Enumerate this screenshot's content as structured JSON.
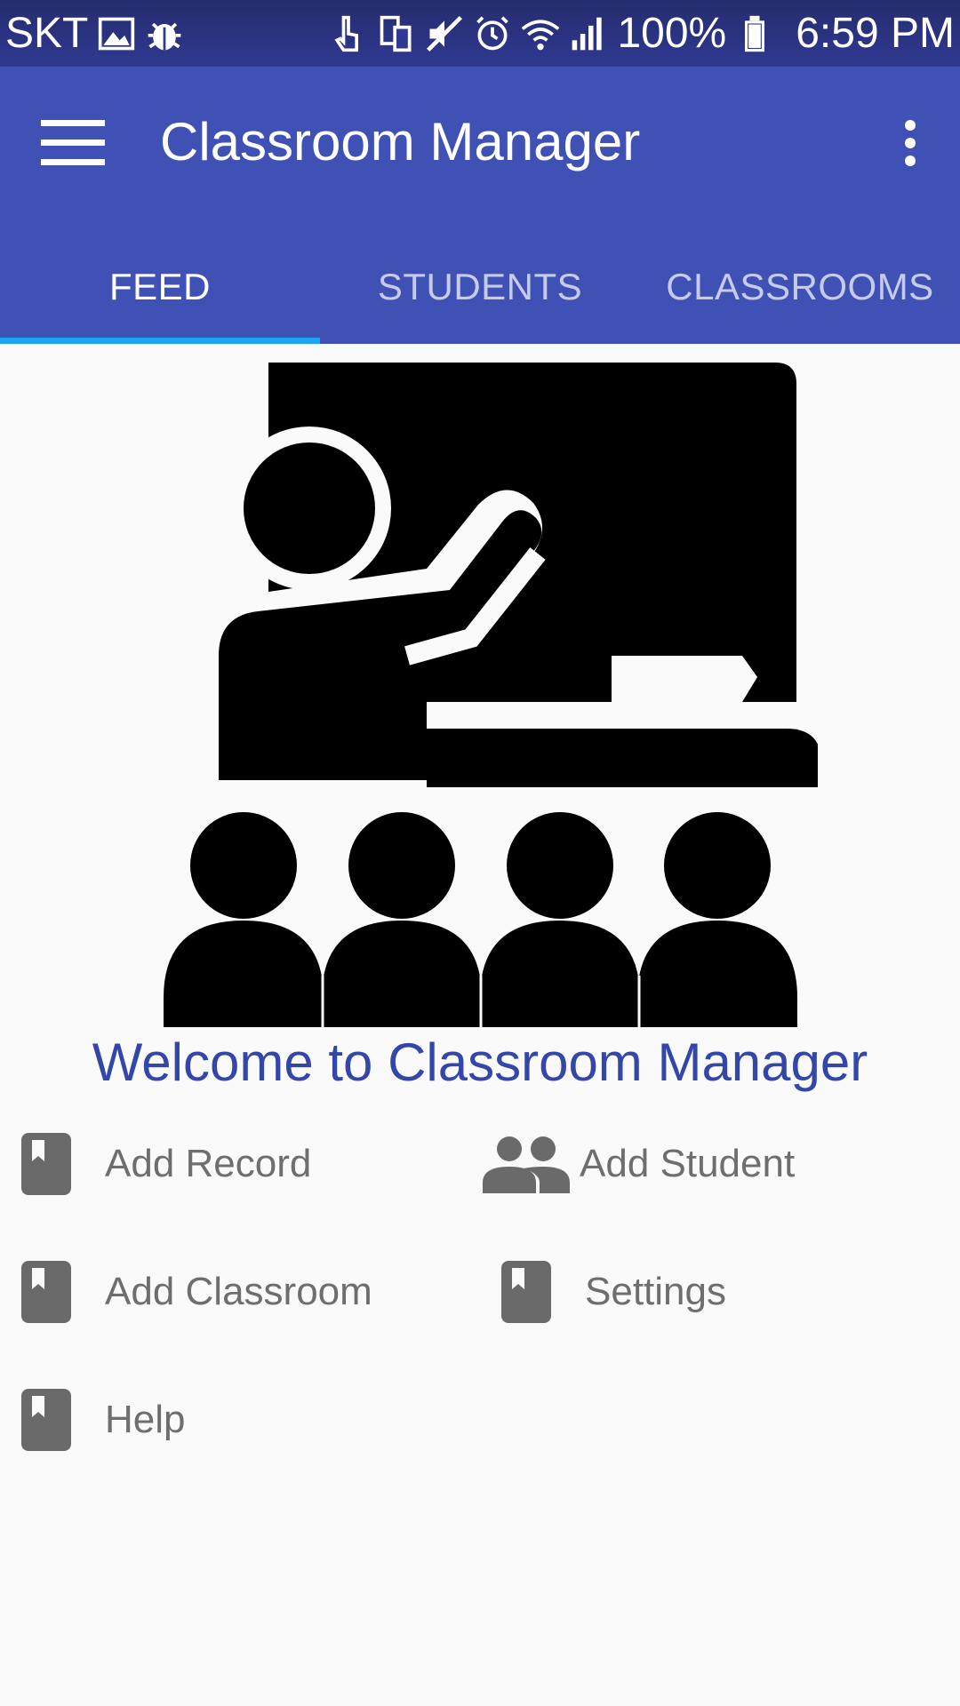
{
  "status_bar": {
    "carrier": "SKT",
    "battery": "100%",
    "time": "6:59 PM",
    "left_icons": [
      "image-icon",
      "bug-icon"
    ],
    "right_icons": [
      "touch-icon",
      "devices-icon",
      "mute-icon",
      "alarm-icon",
      "wifi-icon",
      "signal-icon",
      "battery-icon"
    ]
  },
  "toolbar": {
    "title": "Classroom Manager",
    "menu_icon": "hamburger-menu-icon",
    "overflow_icon": "more-vert-icon"
  },
  "tabs": [
    {
      "label": "FEED",
      "active": true
    },
    {
      "label": "STUDENTS",
      "active": false
    },
    {
      "label": "CLASSROOMS",
      "active": false
    }
  ],
  "main": {
    "illustration_icon": "teacher-classroom-icon",
    "welcome": "Welcome to Classroom Manager",
    "actions": [
      {
        "label": "Add Record",
        "icon": "book-icon"
      },
      {
        "label": "Add Student",
        "icon": "people-icon"
      },
      {
        "label": "Add Classroom",
        "icon": "book-icon"
      },
      {
        "label": "Settings",
        "icon": "book-icon"
      },
      {
        "label": "Help",
        "icon": "book-icon"
      }
    ]
  },
  "colors": {
    "primary": "#3f51b5",
    "status_bar": "#2f3990",
    "tab_indicator": "#1ea5f2",
    "welcome_text": "#3347a9",
    "action_text": "#6e6e6e",
    "action_icon": "#6a6a6a",
    "background": "#fafafa"
  }
}
